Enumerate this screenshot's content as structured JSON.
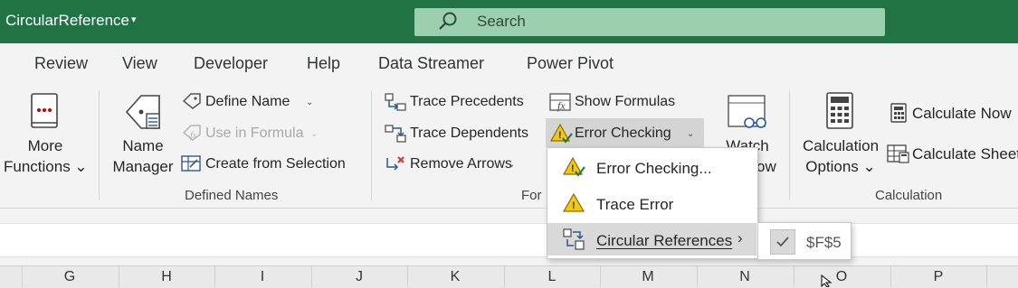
{
  "app": {
    "title": "CircularReference",
    "title_caret": "▾",
    "accent": "#217346"
  },
  "search": {
    "label": "Search"
  },
  "tabs": [
    "Review",
    "View",
    "Developer",
    "Help",
    "Data Streamer",
    "Power Pivot"
  ],
  "ribbon": {
    "more_functions": {
      "line1": "More",
      "line2": "Functions ⌄"
    },
    "defined_names": {
      "name_manager_line1": "Name",
      "name_manager_line2": "Manager",
      "define_name": "Define Name",
      "use_in_formula": "Use in Formula",
      "create_from_selection": "Create from Selection",
      "group_label": "Defined Names"
    },
    "formula_auditing": {
      "trace_precedents": "Trace Precedents",
      "trace_dependents": "Trace Dependents",
      "remove_arrows": "Remove Arrows",
      "show_formulas": "Show Formulas",
      "error_checking": "Error Checking",
      "group_label_partial": "For"
    },
    "watch": {
      "line1": "Watch",
      "line2_partial": "ow"
    },
    "calculation": {
      "options_line1": "Calculation",
      "options_line2": "Options ⌄",
      "calculate_now": "Calculate Now",
      "calculate_sheet": "Calculate Sheet",
      "group_label": "Calculation"
    }
  },
  "dropdown": {
    "items": [
      {
        "label": "Error Checking...",
        "icon": "warning-check-icon"
      },
      {
        "label": "Trace Error",
        "icon": "warning-icon"
      },
      {
        "label": "Circular References",
        "icon": "circular-arrows-icon",
        "submenu": true
      }
    ]
  },
  "submenu": {
    "items": [
      {
        "label": "$F$5",
        "checked": true
      }
    ]
  },
  "columns": [
    "G",
    "H",
    "I",
    "J",
    "K",
    "L",
    "M",
    "N",
    "O",
    "P"
  ]
}
